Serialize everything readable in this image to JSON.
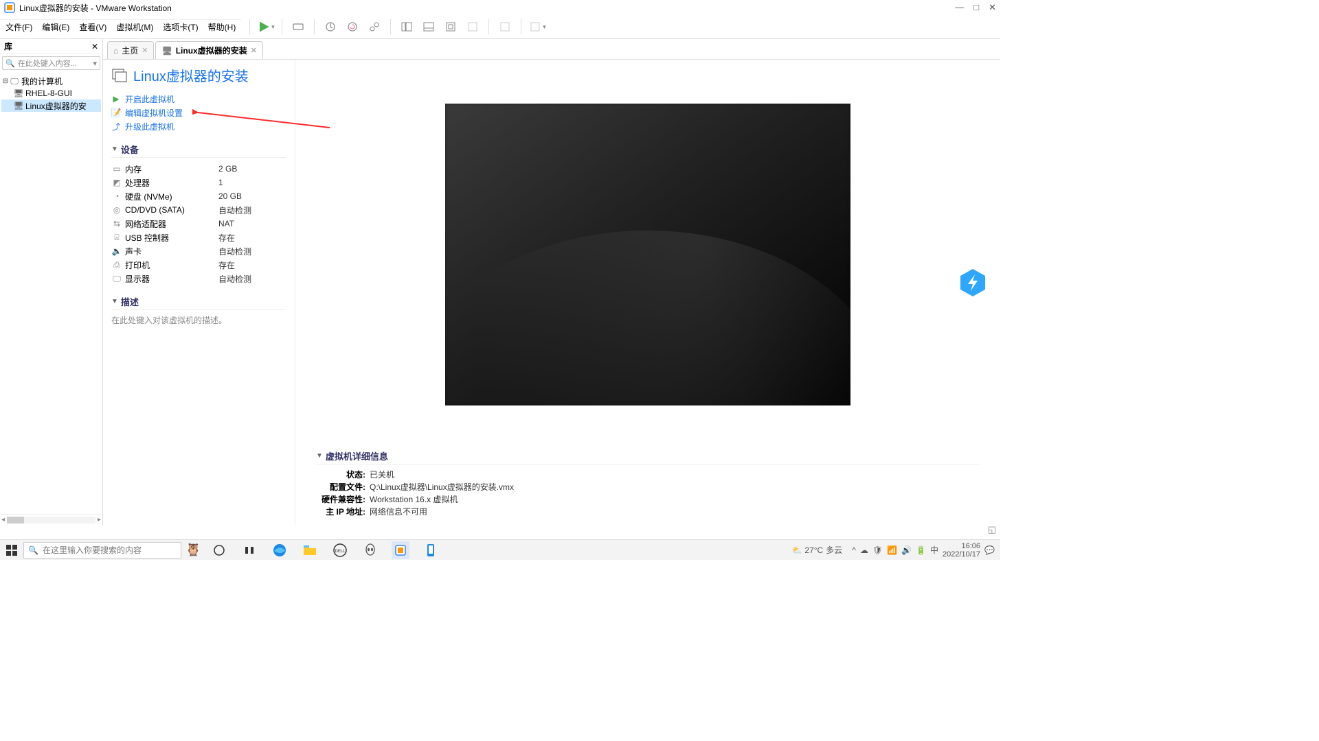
{
  "titlebar": {
    "title": "Linux虚拟器的安装 - VMware Workstation"
  },
  "menubar": {
    "file": "文件(F)",
    "edit": "编辑(E)",
    "view": "查看(V)",
    "vm": "虚拟机(M)",
    "tabs": "选项卡(T)",
    "help": "帮助(H)"
  },
  "library": {
    "header": "库",
    "search_placeholder": "在此处键入内容...",
    "root": "我的计算机",
    "items": [
      "RHEL-8-GUI",
      "Linux虚拟器的安"
    ]
  },
  "tabs": {
    "home": "主页",
    "vm": "Linux虚拟器的安装"
  },
  "vm": {
    "title": "Linux虚拟器的安装",
    "actions": {
      "power_on": "开启此虚拟机",
      "edit_settings": "编辑虚拟机设置",
      "upgrade": "升级此虚拟机"
    },
    "devices_header": "设备",
    "devices": [
      {
        "label": "内存",
        "value": "2 GB"
      },
      {
        "label": "处理器",
        "value": "1"
      },
      {
        "label": "硬盘 (NVMe)",
        "value": "20 GB"
      },
      {
        "label": "CD/DVD (SATA)",
        "value": "自动检测"
      },
      {
        "label": "网络适配器",
        "value": "NAT"
      },
      {
        "label": "USB 控制器",
        "value": "存在"
      },
      {
        "label": "声卡",
        "value": "自动检测"
      },
      {
        "label": "打印机",
        "value": "存在"
      },
      {
        "label": "显示器",
        "value": "自动检测"
      }
    ],
    "description_header": "描述",
    "description_placeholder": "在此处键入对该虚拟机的描述。",
    "details_header": "虚拟机详细信息",
    "details": {
      "state_k": "状态:",
      "state_v": "已关机",
      "config_k": "配置文件:",
      "config_v": "Q:\\Linux虚拟器\\Linux虚拟器的安装.vmx",
      "hw_k": "硬件兼容性:",
      "hw_v": "Workstation 16.x 虚拟机",
      "ip_k": "主 IP 地址:",
      "ip_v": "网络信息不可用"
    }
  },
  "taskbar": {
    "search_placeholder": "在这里输入你要搜索的内容",
    "weather_temp": "27°C",
    "weather_desc": "多云",
    "ime": "中",
    "time": "16:06",
    "date": "2022/10/17"
  }
}
